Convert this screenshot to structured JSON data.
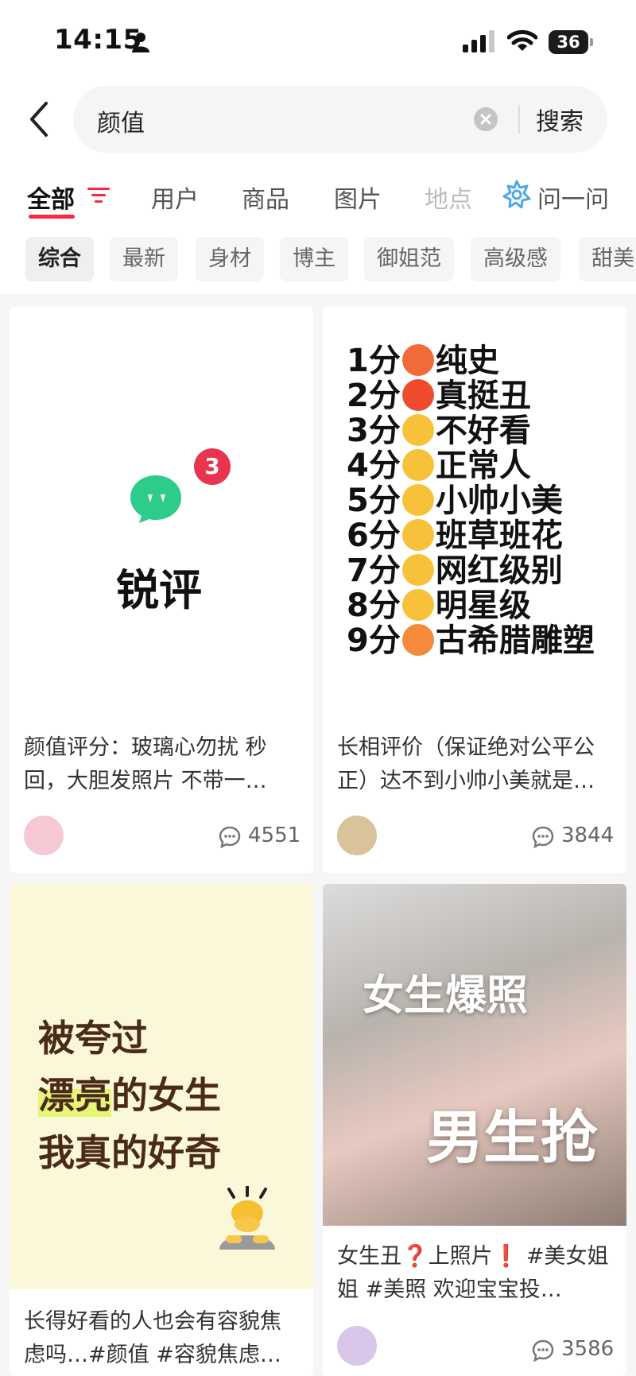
{
  "status_bar": {
    "time": "14:15",
    "battery": "36"
  },
  "search": {
    "query": "颜值",
    "search_label": "搜索"
  },
  "tabs": [
    {
      "label": "全部"
    },
    {
      "label": "用户"
    },
    {
      "label": "商品"
    },
    {
      "label": "图片"
    },
    {
      "label": "地点"
    },
    {
      "label": "问一问"
    }
  ],
  "chips": [
    "综合",
    "最新",
    "身材",
    "博主",
    "御姐范",
    "高级感",
    "甜美"
  ],
  "cards": [
    {
      "cover": {
        "brand": "锐评",
        "badge": "3"
      },
      "title": "颜值评分：玻璃心勿扰 秒回，大胆发照片 不带一…",
      "comments": "4551"
    },
    {
      "cover": {
        "scores": [
          "1分",
          "2分",
          "3分",
          "4分",
          "5分",
          "6分",
          "7分",
          "8分",
          "9分"
        ],
        "labels": [
          "纯史",
          "真挺丑",
          "不好看",
          "正常人",
          "小帅小美",
          "班草班花",
          "网红级别",
          "明星级",
          "古希腊雕塑"
        ]
      },
      "title": "长相评价（保证绝对公平公正）达不到小帅小美就是…",
      "comments": "3844"
    },
    {
      "cover": {
        "line1": "被夸过",
        "line2_hl": "漂亮",
        "line2_rest": "的女生",
        "line3": "我真的好奇"
      },
      "title": "长得好看的人也会有容貌焦虑吗…#颜值 #容貌焦虑…",
      "comments": ""
    },
    {
      "cover": {
        "text1": "女生爆照",
        "text2": "男生抢"
      },
      "title": "女生丑❓上照片❗ #美女姐姐 #美照 欢迎宝宝投…",
      "comments": "3586"
    }
  ],
  "colors": {
    "accent": "#ff2442",
    "badge": "#e8344e",
    "app_green": "#2ecc8a"
  }
}
